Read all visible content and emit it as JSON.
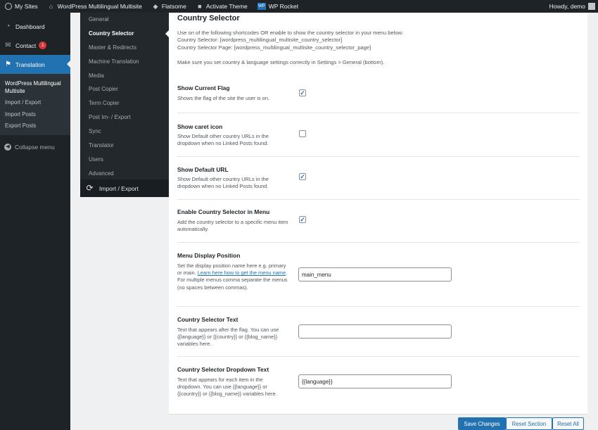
{
  "adminbar": {
    "my_sites": "My Sites",
    "site_name": "WordPress Multilingual Multisite",
    "flatsome": "Flatsome",
    "activate_theme": "Activate Theme",
    "wp_rocket": "WP Rocket",
    "howdy": "Howdy, demo"
  },
  "menu": {
    "dashboard": "Dashboard",
    "contact": "Contact",
    "contact_badge": "1",
    "translation": "Translation",
    "sub_items": [
      "WordPress Multilingual Multisite",
      "Import / Export",
      "Import Posts",
      "Export Posts"
    ],
    "collapse": "Collapse menu"
  },
  "redux_nav": {
    "items": [
      "General",
      "Country Selector",
      "Master & Redirects",
      "Machine Translation",
      "Media",
      "Post Copier",
      "Term Copier",
      "Post Im- / Export",
      "Sync",
      "Translator",
      "Users",
      "Advanced"
    ],
    "active_index": 1,
    "import_export": "Import / Export"
  },
  "section": {
    "title": "Country Selector",
    "desc_lines": [
      "Use on of the following shortcodes OR enable to show the country selector in your menu below:",
      "Country Selector: [wordpress_multilingual_multisite_country_selector]",
      "Country Selector Page: [wordpress_multilingual_multisite_country_selector_page]",
      "",
      "Make sure you set country & language settings correctly in Settings > General (bottom)."
    ]
  },
  "fields": {
    "show_flag": {
      "label": "Show Current Flag",
      "desc": "Shows the flag of the site the user is on.",
      "checked": true
    },
    "show_caret": {
      "label": "Show caret icon",
      "desc": "Show Default other country URLs in the dropdown when no Linked Posts found.",
      "checked": false
    },
    "show_default_url": {
      "label": "Show Default URL",
      "desc": "Show Default other country URLs in the dropdown when no Linked Posts found.",
      "checked": true
    },
    "enable_menu": {
      "label": "Enable Country Selector in Menu",
      "desc": "Add the country selector to a specific menu item automatically.",
      "checked": true
    },
    "menu_position": {
      "label": "Menu Display Position",
      "desc_before": "Set the display position name here e.g. primary or main.",
      "link": "Learn here how to get the menu name",
      "desc_after": ". For multiple menus comma separate the menus (no spaces between commas).",
      "value": "main_menu"
    },
    "selector_text": {
      "label": "Country Selector Text",
      "desc": "Text that appears after the flag. You can use {{language}} or {{country}} or {{blog_name}} variables here.",
      "value": ""
    },
    "dropdown_text": {
      "label": "Country Selector Dropdown Text",
      "desc": "Text that appears for each item in the dropdown. You can use {{language}} or {{country}} or {{blog_name}} variables here.",
      "value": "{{language}}"
    }
  },
  "footer": {
    "save": "Save Changes",
    "reset_section": "Reset Section",
    "reset_all": "Reset All"
  },
  "colors": {
    "accent": "#2271b1",
    "adminbar": "#1d2327",
    "badge": "#d63638"
  },
  "icons": [
    "wordpress-icon",
    "home-icon",
    "flatsome-icon",
    "lock-icon",
    "wp-rocket-icon",
    "dashboard-icon",
    "mail-icon",
    "flag-icon",
    "collapse-icon",
    "refresh-icon",
    "check-icon"
  ]
}
